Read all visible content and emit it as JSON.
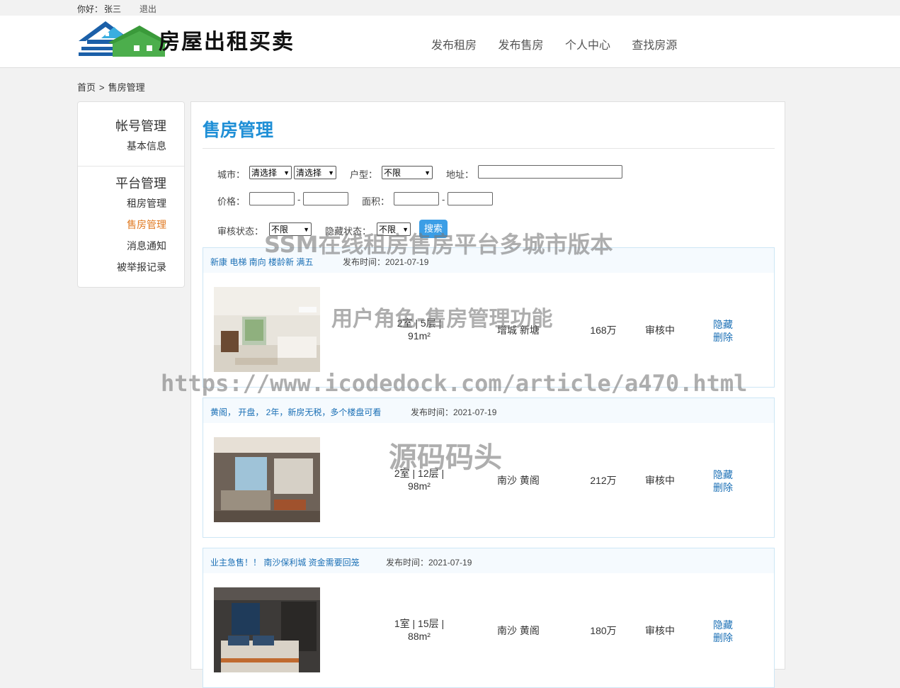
{
  "topbar": {
    "greeting": "你好：",
    "username": "张三",
    "logout": "退出"
  },
  "header": {
    "logo_text": "房屋出租买卖",
    "nav": [
      "发布租房",
      "发布售房",
      "个人中心",
      "查找房源"
    ]
  },
  "breadcrumb": {
    "home": "首页",
    "separator": ">",
    "current": "售房管理"
  },
  "sidebar": {
    "group1": "帐号管理",
    "group1_items": [
      "基本信息"
    ],
    "group2": "平台管理",
    "group2_items": [
      "租房管理",
      "售房管理",
      "消息通知",
      "被举报记录"
    ],
    "active_item": "售房管理"
  },
  "main": {
    "title": "售房管理",
    "filters": {
      "city_label": "城市：",
      "city_value": "清选择",
      "district_value": "清选择",
      "layout_label": "户型：",
      "layout_value": "不限",
      "address_label": "地址：",
      "price_label": "价格：",
      "area_label": "面积：",
      "range_dash": "-",
      "audit_label": "审核状态：",
      "audit_value": "不限",
      "hidden_label": "隐藏状态：",
      "hidden_value": "不限",
      "search_button": "搜索"
    },
    "listings": [
      {
        "title": "新康 电梯 南向 楼龄新 满五",
        "date": "发布时间：2021-07-19",
        "layout_line1": "2室 | 5层 |",
        "layout_line2": "91m²",
        "address": "增城 新塘",
        "price": "168万",
        "status": "审核中",
        "hide": "隐藏",
        "delete": "删除"
      },
      {
        "title": "黄阁， 开盘， 2年，新房无税，多个楼盘可看",
        "date": "发布时间：2021-07-19",
        "layout_line1": "2室 | 12层 |",
        "layout_line2": "98m²",
        "address": "南沙 黄阁",
        "price": "212万",
        "status": "审核中",
        "hide": "隐藏",
        "delete": "删除"
      },
      {
        "title": "业主急售！！ 南沙保利城 资金需要回笼",
        "date": "发布时间：2021-07-19",
        "layout_line1": "1室 | 15层 |",
        "layout_line2": "88m²",
        "address": "南沙 黄阁",
        "price": "180万",
        "status": "审核中",
        "hide": "隐藏",
        "delete": "删除"
      }
    ]
  },
  "watermarks": {
    "line1": "SSM在线租房售房平台多城市版本",
    "line2": "用户角色-售房管理功能",
    "line3": "https://www.icodedock.com/article/a470.html",
    "line4": "源码码头"
  },
  "colors": {
    "accent_blue": "#1f8fd6",
    "active_orange": "#e07a22",
    "link_blue": "#1a6fb5",
    "button_blue": "#3b9ee6"
  }
}
